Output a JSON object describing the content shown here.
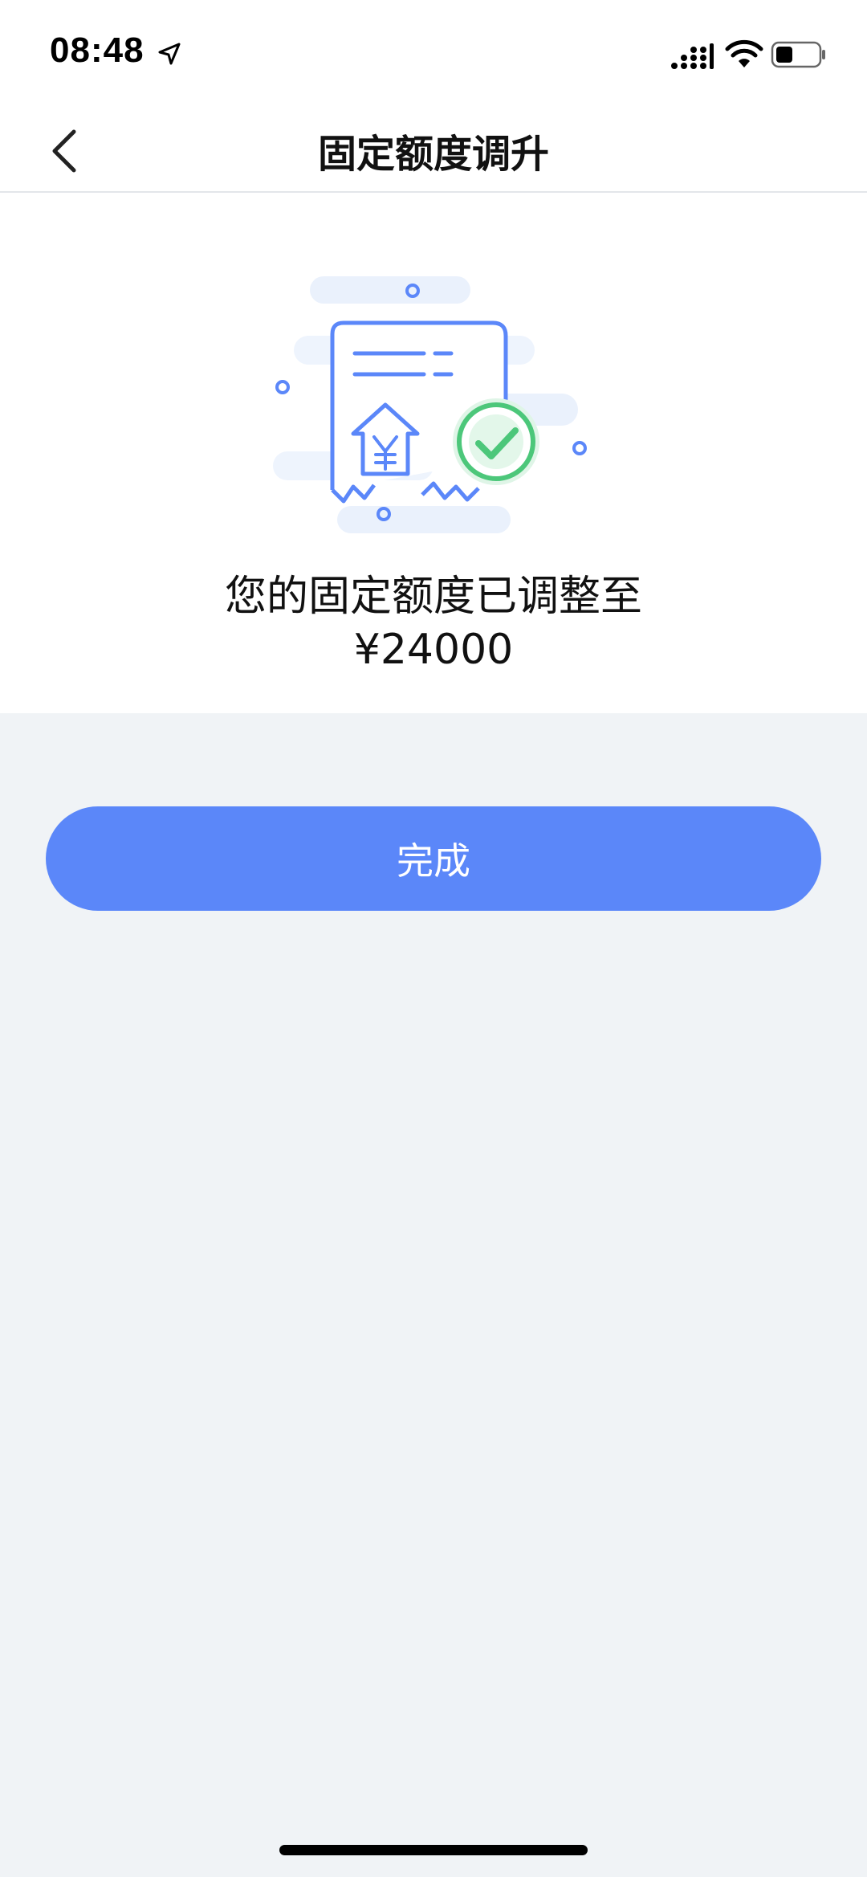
{
  "status_bar": {
    "time": "08:48"
  },
  "nav": {
    "title": "固定额度调升",
    "back_icon": "chevron-left-icon"
  },
  "result": {
    "line1": "您的固定额度已调整至",
    "amount": "¥24000",
    "illustration_icon": "receipt-check-icon"
  },
  "actions": {
    "done_label": "完成"
  },
  "colors": {
    "accent": "#5b87f9",
    "success": "#4cc77a",
    "page_background": "#f0f3f6"
  }
}
